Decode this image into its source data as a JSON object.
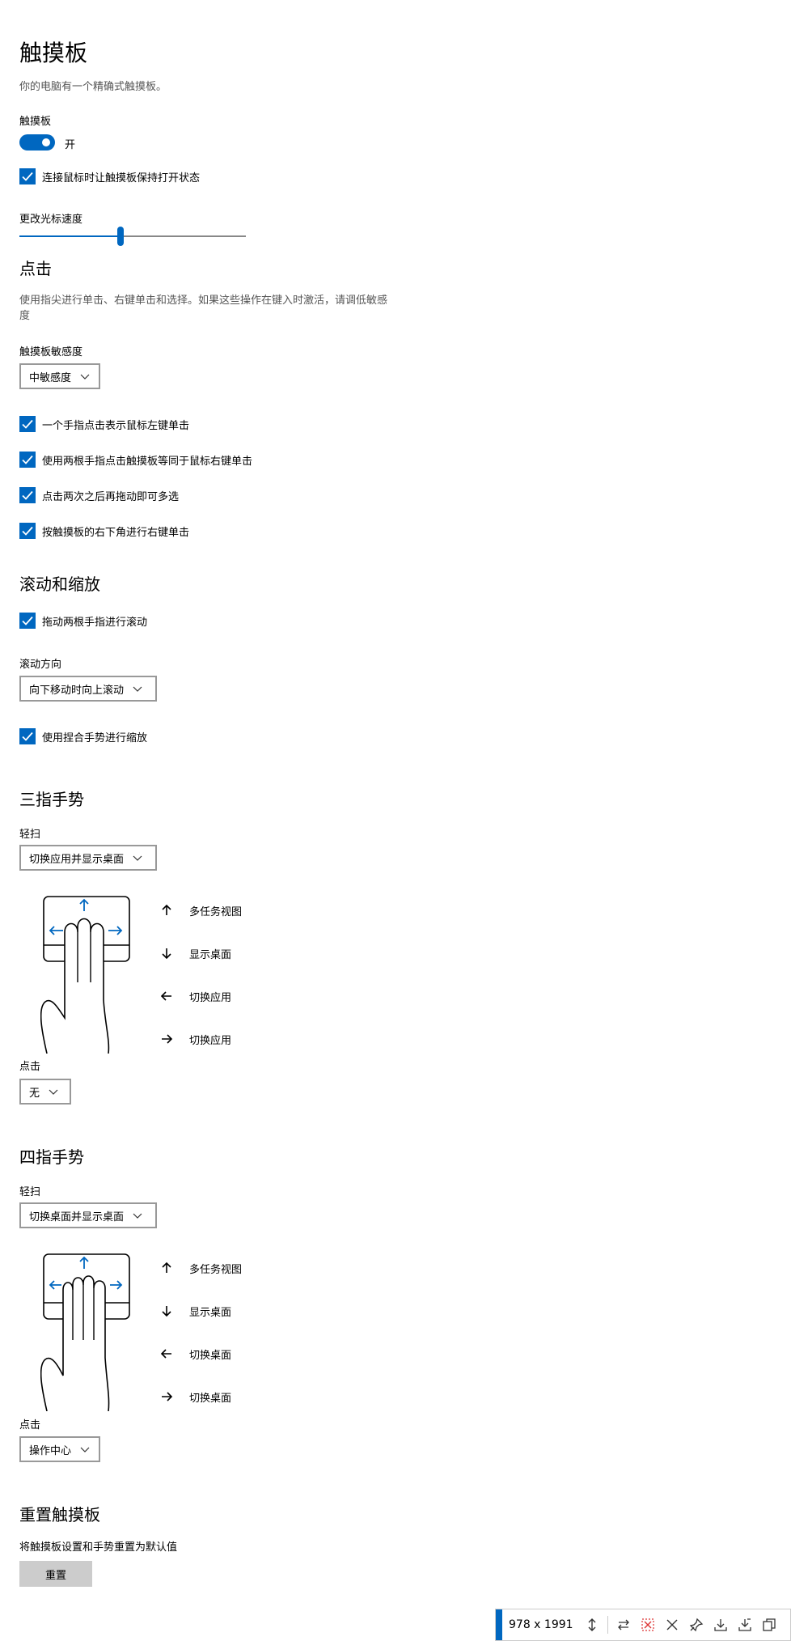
{
  "page": {
    "title": "触摸板",
    "subtitle": "你的电脑有一个精确式触摸板。"
  },
  "touchpad": {
    "label": "触摸板",
    "toggle_state": "开",
    "keep_on_with_mouse": "连接鼠标时让触摸板保持打开状态",
    "cursor_speed_label": "更改光标速度",
    "cursor_speed_level": 0.45
  },
  "taps": {
    "heading": "点击",
    "description": "使用指尖进行单击、右键单击和选择。如果这些操作在键入时激活，请调低敏感度",
    "sensitivity_label": "触摸板敏感度",
    "sensitivity_value": "中敏感度",
    "options": [
      "一个手指点击表示鼠标左键单击",
      "使用两根手指点击触摸板等同于鼠标右键单击",
      "点击两次之后再拖动即可多选",
      "按触摸板的右下角进行右键单击"
    ]
  },
  "scroll_zoom": {
    "heading": "滚动和缩放",
    "drag_two_fingers": "拖动两根手指进行滚动",
    "direction_label": "滚动方向",
    "direction_value": "向下移动时向上滚动",
    "pinch_zoom": "使用捏合手势进行缩放"
  },
  "three_finger": {
    "heading": "三指手势",
    "swipe_label": "轻扫",
    "swipe_value": "切换应用并显示桌面",
    "gestures": {
      "up": "多任务视图",
      "down": "显示桌面",
      "left": "切换应用",
      "right": "切换应用"
    },
    "tap_label": "点击",
    "tap_value": "无"
  },
  "four_finger": {
    "heading": "四指手势",
    "swipe_label": "轻扫",
    "swipe_value": "切换桌面并显示桌面",
    "gestures": {
      "up": "多任务视图",
      "down": "显示桌面",
      "left": "切换桌面",
      "right": "切换桌面"
    },
    "tap_label": "点击",
    "tap_value": "操作中心"
  },
  "reset": {
    "heading": "重置触摸板",
    "description": "将触摸板设置和手势重置为默认值",
    "button": "重置"
  },
  "screenshot_toolbar": {
    "dimensions": "978 x 1991"
  },
  "colors": {
    "accent": "#0067c0",
    "button_bg": "#cccccc"
  }
}
